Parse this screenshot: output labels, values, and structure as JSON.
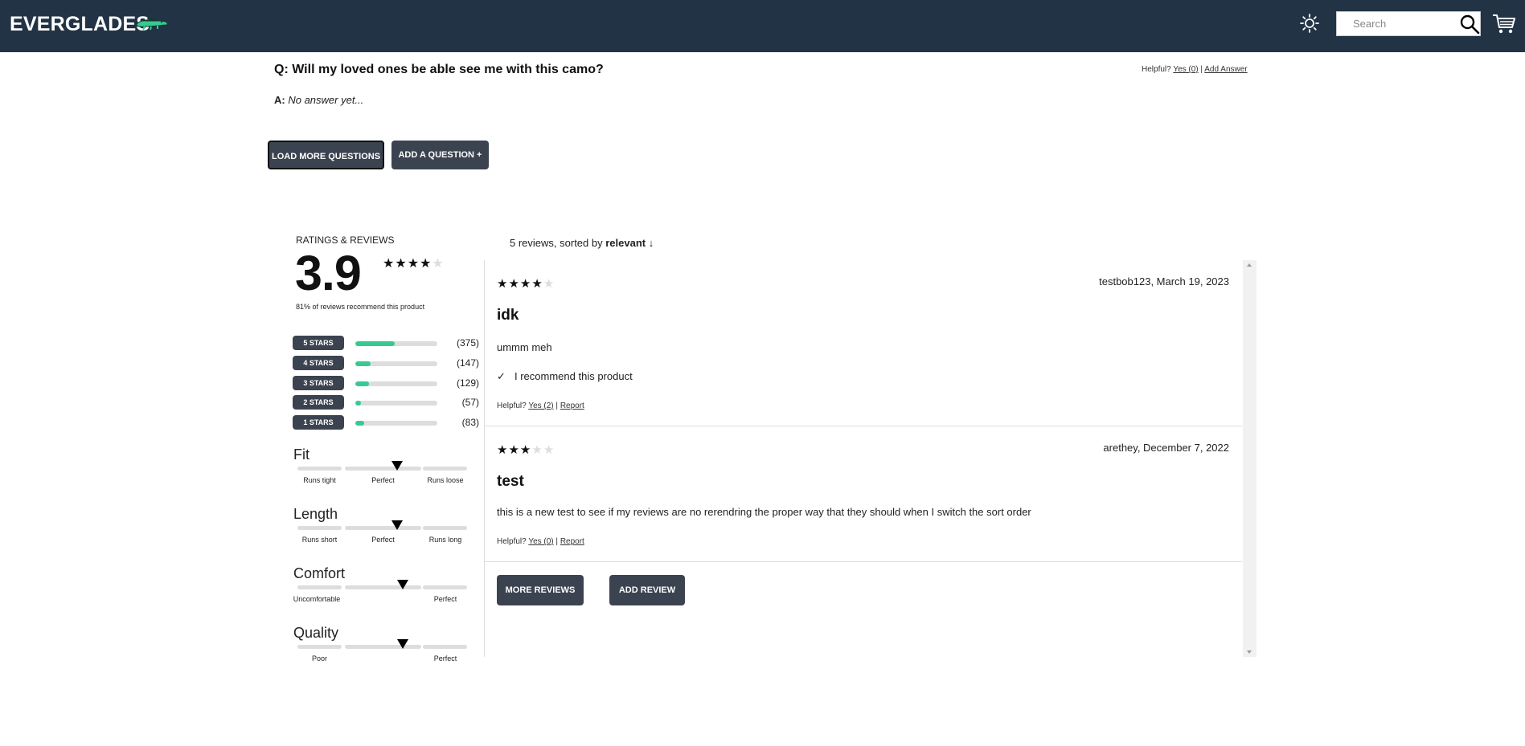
{
  "header": {
    "logo_text": "EVERGLADES",
    "logo_icon": "alligator-logo",
    "theme_icon": "sun-icon",
    "search_placeholder": "Search",
    "search_icon": "search-icon",
    "cart_icon": "cart-icon",
    "colors": {
      "background": "#223345"
    }
  },
  "qa": {
    "question": "Q: Will my loved ones be able see me with this camo?",
    "helpful_label": "Helpful?",
    "helpful_yes": "Yes (0)",
    "separator": "|",
    "add_answer": "Add Answer",
    "answer_prefix": "A:",
    "answer_text": "No answer yet...",
    "load_more_label": "LOAD MORE QUESTIONS",
    "add_question_label": "ADD A QUESTION +"
  },
  "ratings": {
    "title": "RATINGS & REVIEWS",
    "average": "3.9",
    "average_stars": 3.9,
    "recommend_text": "81% of reviews recommend this product",
    "accent_color": "#37c992",
    "breakdown": [
      {
        "label": "5 STARS",
        "count": "(375)",
        "fraction": 0.48
      },
      {
        "label": "4 STARS",
        "count": "(147)",
        "fraction": 0.19
      },
      {
        "label": "3 STARS",
        "count": "(129)",
        "fraction": 0.17
      },
      {
        "label": "2 STARS",
        "count": "(57)",
        "fraction": 0.07
      },
      {
        "label": "1 STARS",
        "count": "(83)",
        "fraction": 0.11
      }
    ],
    "characteristics": [
      {
        "name": "Fit",
        "low": "Runs tight",
        "mid": "Perfect",
        "high": "Runs loose",
        "value": 0.59
      },
      {
        "name": "Length",
        "low": "Runs short",
        "mid": "Perfect",
        "high": "Runs long",
        "value": 0.59
      },
      {
        "name": "Comfort",
        "low": "Uncomfortable",
        "mid": "",
        "high": "Perfect",
        "value": 0.62
      },
      {
        "name": "Quality",
        "low": "Poor",
        "mid": "",
        "high": "Perfect",
        "value": 0.62
      }
    ]
  },
  "reviews": {
    "sort_prefix": "5 reviews, sorted by",
    "sort_value": "relevant ↓",
    "items": [
      {
        "stars": 4,
        "meta": "testbob123, March 19, 2023",
        "title": "idk",
        "body": "ummm meh",
        "recommend": "I recommend this product",
        "helpful_label": "Helpful?",
        "helpful_yes": "Yes (2)",
        "separator": "|",
        "report": "Report"
      },
      {
        "stars": 3,
        "meta": "arethey, December 7, 2022",
        "title": "test",
        "body": "this is a new test to see if my reviews are no rerendring the proper way that they should when I switch the sort order",
        "recommend": "",
        "helpful_label": "Helpful?",
        "helpful_yes": "Yes (0)",
        "separator": "|",
        "report": "Report"
      }
    ],
    "more_reviews_label": "MORE REVIEWS",
    "add_review_label": "ADD REVIEW"
  }
}
